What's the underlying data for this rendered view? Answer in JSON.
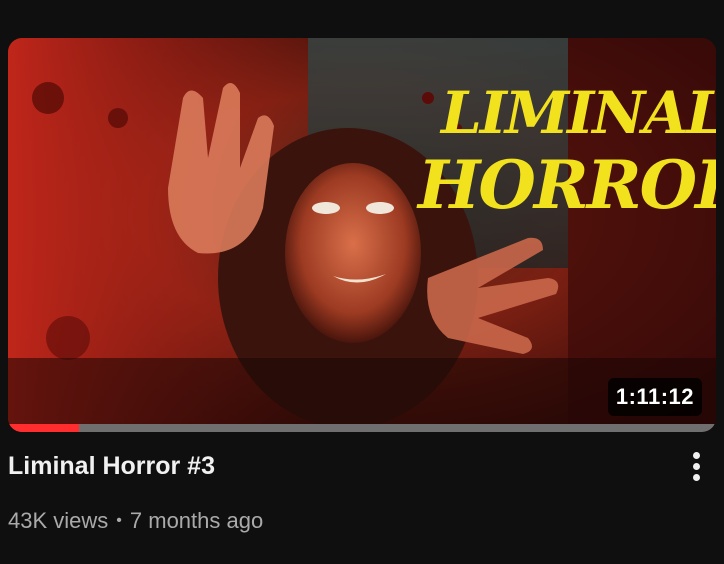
{
  "video": {
    "title": "Liminal Horror #3",
    "duration": "1:11:12",
    "views": "43K views",
    "separator": "•",
    "published": "7 months ago",
    "watched_progress": 0.1
  },
  "thumbnail": {
    "logo_line1": "LIMINAL",
    "logo_line2": "HORROR"
  },
  "colors": {
    "background": "#0f0f0f",
    "progress": "#ff2d2d",
    "logo": "#f2e11d"
  },
  "icons": {
    "menu": "more-vert-icon"
  }
}
